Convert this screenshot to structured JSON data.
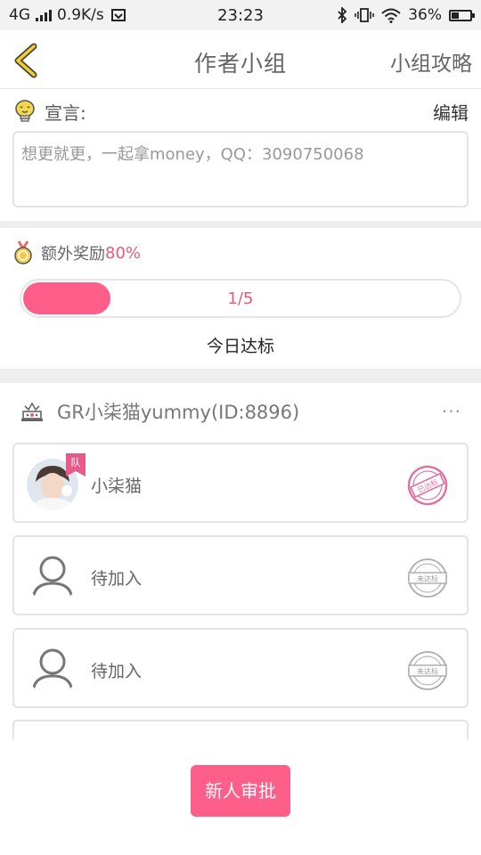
{
  "status_bar": {
    "network": "4G",
    "speed": "0.9K/s",
    "time": "23:23",
    "battery": "36%",
    "battery_level": 0.36
  },
  "header": {
    "title": "作者小组",
    "right_link": "小组攻略"
  },
  "slogan": {
    "label": "宣言:",
    "edit_label": "编辑",
    "text": "想更就更，一起拿money，QQ：3090750068"
  },
  "reward": {
    "label": "额外奖励",
    "percent": "80%",
    "progress_text": "1/5",
    "progress_value": 0.2,
    "goal_label": "今日达标"
  },
  "group": {
    "name": "GR小柒猫yummy(ID:8896)",
    "more": "···"
  },
  "members": [
    {
      "name": "小柒猫",
      "badge": "队",
      "stamp": "已达标",
      "status": "met"
    },
    {
      "name": "待加入",
      "stamp": "未达标",
      "status": "unmet"
    },
    {
      "name": "待加入",
      "stamp": "未达标",
      "status": "unmet"
    }
  ],
  "footer": {
    "approve_label": "新人审批"
  },
  "colors": {
    "accent": "#fd5e8a",
    "accent_text": "#e85a78"
  }
}
